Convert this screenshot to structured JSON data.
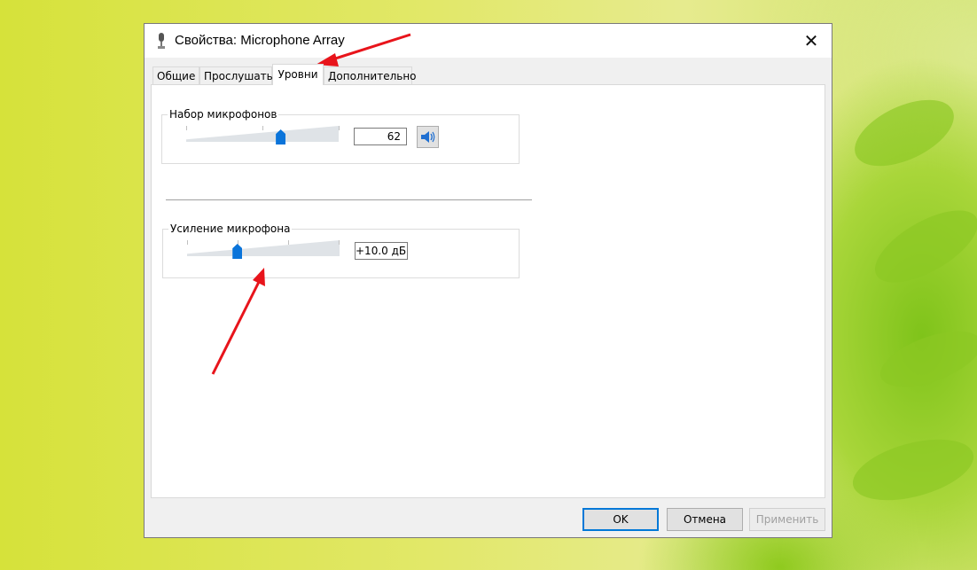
{
  "window": {
    "title": "Свойства: Microphone Array",
    "close_glyph": "✕"
  },
  "tabs": [
    {
      "label": "Общие",
      "active": false
    },
    {
      "label": "Прослушать",
      "active": false
    },
    {
      "label": "Уровни",
      "active": true
    },
    {
      "label": "Дополнительно",
      "active": false
    }
  ],
  "levels": {
    "mic_array": {
      "label": "Набор микрофонов",
      "value": "62",
      "level_fraction": 0.62
    },
    "mic_boost": {
      "label": "Усиление микрофона",
      "value": "+10.0 дБ",
      "level_fraction": 0.33
    }
  },
  "buttons": {
    "ok": "OK",
    "cancel": "Отмена",
    "apply": "Применить"
  },
  "colors": {
    "accent": "#0078d7",
    "thumb": "#0a74da",
    "arrow": "#e8141b"
  },
  "icons": {
    "title": "microphone-icon",
    "speaker": "speaker-icon",
    "close": "close-icon"
  }
}
